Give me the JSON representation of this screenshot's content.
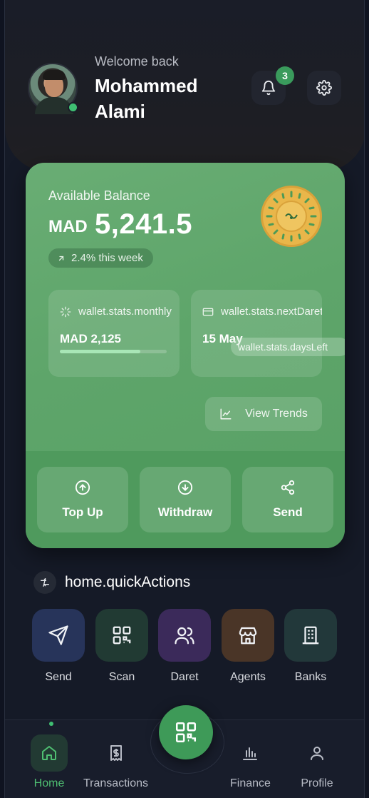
{
  "header": {
    "welcome_text": "Welcome back",
    "user_name": "Mohammed Alami",
    "notification_count": "3"
  },
  "wallet": {
    "balance_label": "Available Balance",
    "currency": "MAD",
    "balance": "5,241.5",
    "weekly_change": "2.4% this week",
    "stats": {
      "monthly_label": "wallet.stats.monthly",
      "monthly_value": "MAD 2,125",
      "monthly_progress_fraction": 0.75,
      "next_daret_label": "wallet.stats.nextDaret",
      "next_daret_date": "15 May",
      "days_left_label": "wallet.stats.daysLeft"
    },
    "view_trends_label": "View Trends",
    "actions": [
      {
        "label": "Top Up",
        "icon": "arrow-up-circle-icon"
      },
      {
        "label": "Withdraw",
        "icon": "arrow-down-circle-icon"
      },
      {
        "label": "Send",
        "icon": "share-icon"
      }
    ]
  },
  "quick_actions": {
    "title": "home.quickActions",
    "items": [
      {
        "label": "Send",
        "icon": "send-icon",
        "color": "#27345a"
      },
      {
        "label": "Scan",
        "icon": "qr-code-icon",
        "color": "#213a33"
      },
      {
        "label": "Daret",
        "icon": "users-icon",
        "color": "#3b2a5a"
      },
      {
        "label": "Agents",
        "icon": "store-icon",
        "color": "#4a3527"
      },
      {
        "label": "Banks",
        "icon": "bank-icon",
        "color": "#22383a"
      }
    ]
  },
  "bottom_nav": {
    "items": [
      {
        "label": "Home",
        "icon": "home-icon",
        "active": true
      },
      {
        "label": "Transactions",
        "icon": "receipt-icon",
        "active": false
      },
      {
        "label": "Finance",
        "icon": "bar-chart-icon",
        "active": false
      },
      {
        "label": "Profile",
        "icon": "user-icon",
        "active": false
      }
    ],
    "center_button_icon": "qr-code-icon"
  },
  "colors": {
    "accent_green": "#3e9a58",
    "wallet_green": "#5ea56a",
    "background": "#151a27"
  }
}
